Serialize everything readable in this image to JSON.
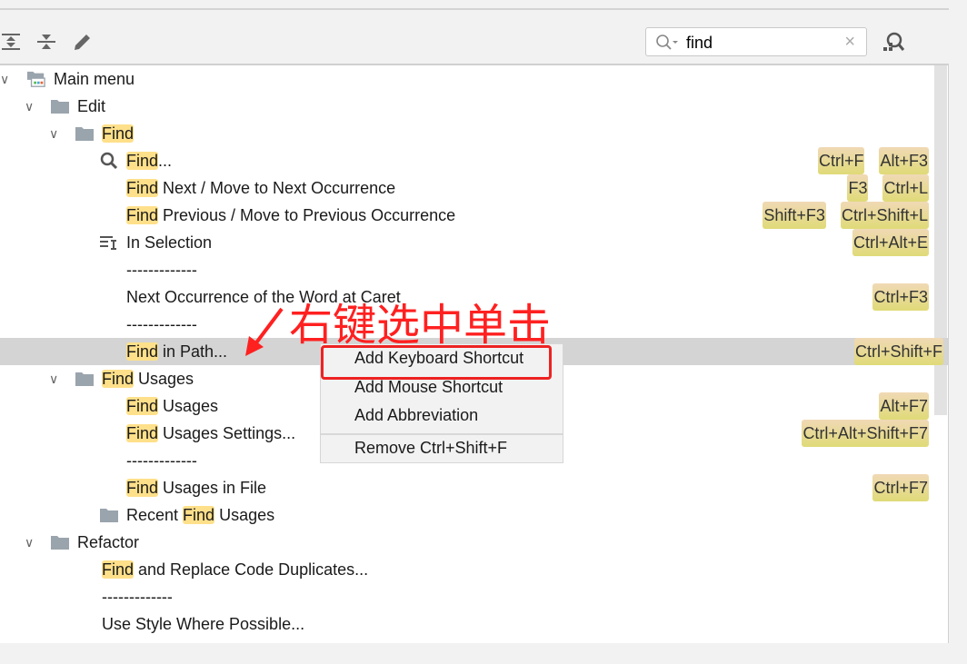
{
  "toolbar": {
    "icons": [
      "expand-all-icon",
      "collapse-all-icon",
      "edit-icon"
    ],
    "search_value": "find",
    "find_by_shortcut_icon": "find-shortcut-icon"
  },
  "tree": [
    {
      "level": 0,
      "icon": "main-menu-icon",
      "expanded": true,
      "segs": [
        [
          "",
          "Main menu"
        ]
      ]
    },
    {
      "level": 1,
      "icon": "folder",
      "expanded": true,
      "segs": [
        [
          "",
          "Edit"
        ]
      ]
    },
    {
      "level": 2,
      "icon": "folder",
      "expanded": true,
      "segs": [
        [
          "Find",
          ""
        ]
      ]
    },
    {
      "level": 3,
      "icon": "search",
      "segs": [
        [
          "Find",
          "..."
        ]
      ],
      "keys": [
        "Ctrl+F",
        "Alt+F3"
      ]
    },
    {
      "level": 3,
      "segs": [
        [
          "Find",
          " Next / Move to Next Occurrence"
        ]
      ],
      "keys": [
        "F3",
        "Ctrl+L"
      ]
    },
    {
      "level": 3,
      "segs": [
        [
          "Find",
          " Previous / Move to Previous Occurrence"
        ]
      ],
      "keys": [
        "Shift+F3",
        "Ctrl+Shift+L"
      ]
    },
    {
      "level": 3,
      "icon": "selection",
      "segs": [
        [
          "",
          "In Selection"
        ]
      ],
      "keys": [
        "Ctrl+Alt+E"
      ]
    },
    {
      "level": 3,
      "segs": [
        [
          "",
          "-------------"
        ]
      ]
    },
    {
      "level": 3,
      "segs": [
        [
          "",
          "Next Occurrence of the Word at Caret"
        ]
      ],
      "keys": [
        "Ctrl+F3"
      ]
    },
    {
      "level": 3,
      "segs": [
        [
          "",
          "-------------"
        ]
      ]
    },
    {
      "level": 3,
      "selected": true,
      "segs": [
        [
          "Find",
          " in Path..."
        ]
      ],
      "keys": [
        "Ctrl+Shift+F"
      ]
    },
    {
      "level": 2,
      "icon": "folder",
      "expanded": true,
      "segs": [
        [
          "Find",
          " Usages"
        ]
      ]
    },
    {
      "level": 3,
      "segs": [
        [
          "Find",
          " Usages"
        ]
      ],
      "keys": [
        "Alt+F7"
      ]
    },
    {
      "level": 3,
      "segs": [
        [
          "Find",
          " Usages Settings..."
        ]
      ],
      "keys": [
        "Ctrl+Alt+Shift+F7"
      ]
    },
    {
      "level": 3,
      "segs": [
        [
          "",
          "-------------"
        ]
      ]
    },
    {
      "level": 3,
      "segs": [
        [
          "Find",
          " Usages in File"
        ]
      ],
      "keys": [
        "Ctrl+F7"
      ]
    },
    {
      "level": 3,
      "icon": "folder",
      "segs": [
        [
          "",
          "Recent "
        ],
        [
          "Find",
          " Usages"
        ]
      ]
    },
    {
      "level": 1,
      "icon": "folder",
      "expanded": true,
      "segs": [
        [
          "",
          "Refactor"
        ]
      ]
    },
    {
      "level": 2,
      "segs": [
        [
          "Find",
          " and Replace Code Duplicates..."
        ]
      ]
    },
    {
      "level": 2,
      "segs": [
        [
          "",
          "-------------"
        ]
      ]
    },
    {
      "level": 2,
      "segs": [
        [
          "",
          "Use Style Where Possible..."
        ]
      ]
    }
  ],
  "context_menu": {
    "items": [
      "Add Keyboard Shortcut",
      "Add Mouse Shortcut",
      "Add Abbreviation",
      "Remove Ctrl+Shift+F"
    ]
  },
  "annotation": {
    "text": "右键选中单击",
    "color": "#ff2020"
  },
  "colors": {
    "highlight": "#ffe08a",
    "selection": "#d4d4d4",
    "annotation": "#ee2222"
  }
}
